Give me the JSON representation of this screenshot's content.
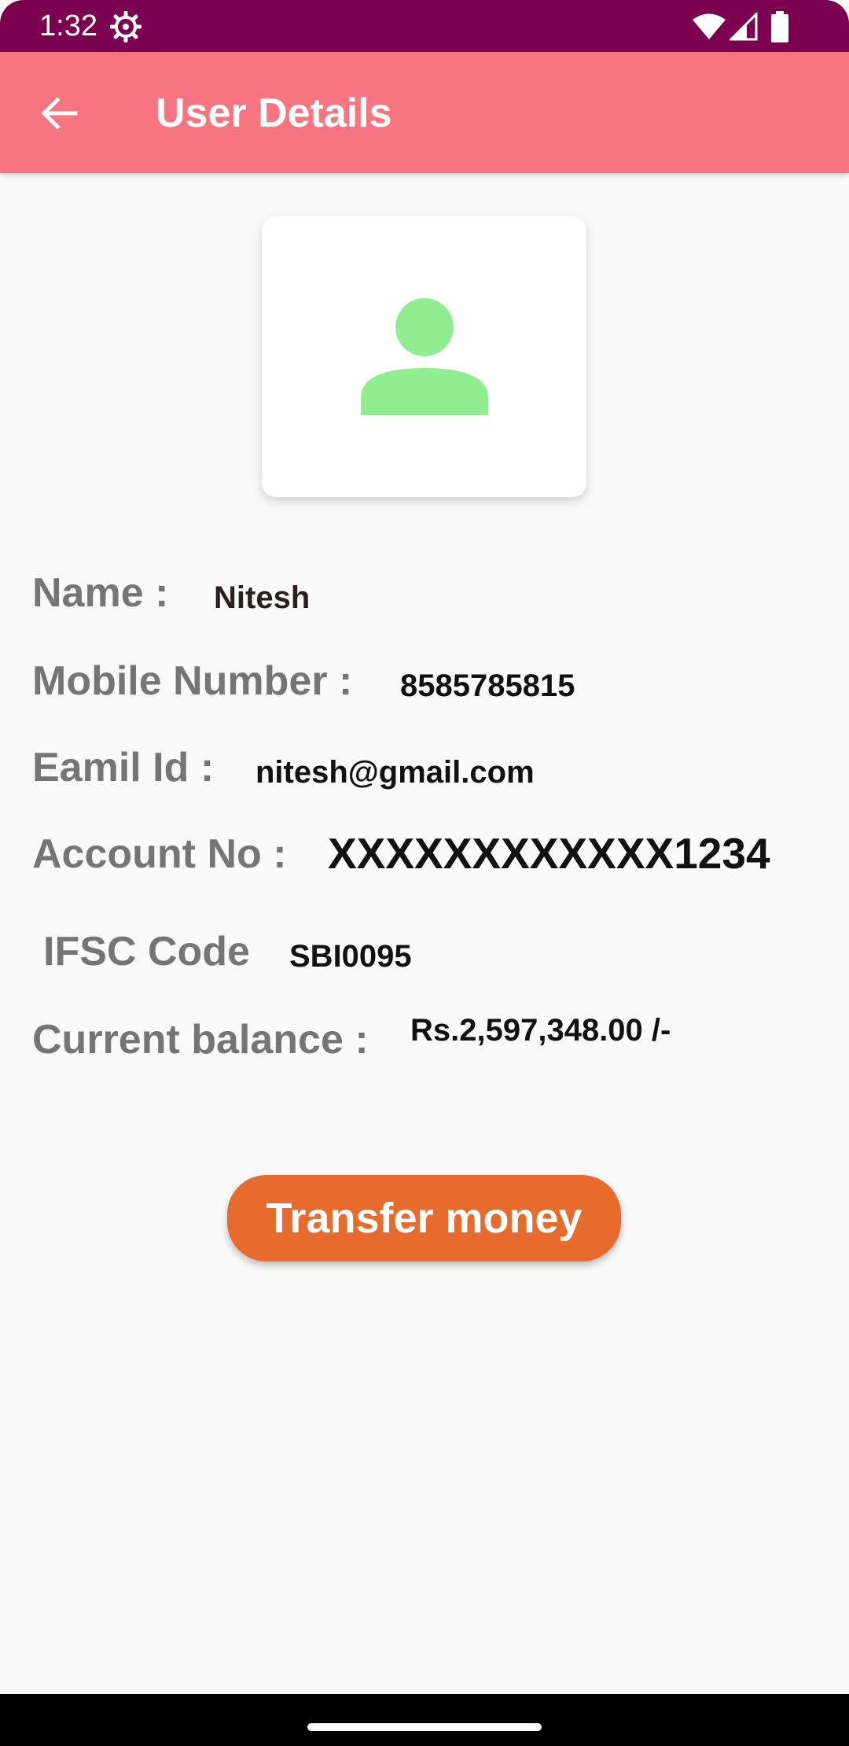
{
  "status_bar": {
    "time": "1:32",
    "icons": [
      "gear-icon",
      "wifi-icon",
      "signal-icon",
      "battery-icon"
    ],
    "background": "#7b0150"
  },
  "app_bar": {
    "title": "User Details",
    "back_icon": "arrow-left-icon",
    "background": "#f77581"
  },
  "avatar": {
    "icon": "person-icon",
    "color": "#90ee90"
  },
  "details": {
    "name_label": "Name :",
    "name_value": "Nitesh",
    "mobile_label": "Mobile Number :",
    "mobile_value": "8585785815",
    "email_label": "Eamil Id :",
    "email_value": "nitesh@gmail.com",
    "account_label": "Account No :",
    "account_value": "XXXXXXXXXXXX1234",
    "ifsc_label": "IFSC Code",
    "ifsc_value": "SBI0095",
    "balance_label": "Current balance :",
    "balance_value": "Rs.2,597,348.00 /-"
  },
  "actions": {
    "transfer_label": "Transfer money",
    "transfer_color": "#e76b2d"
  }
}
